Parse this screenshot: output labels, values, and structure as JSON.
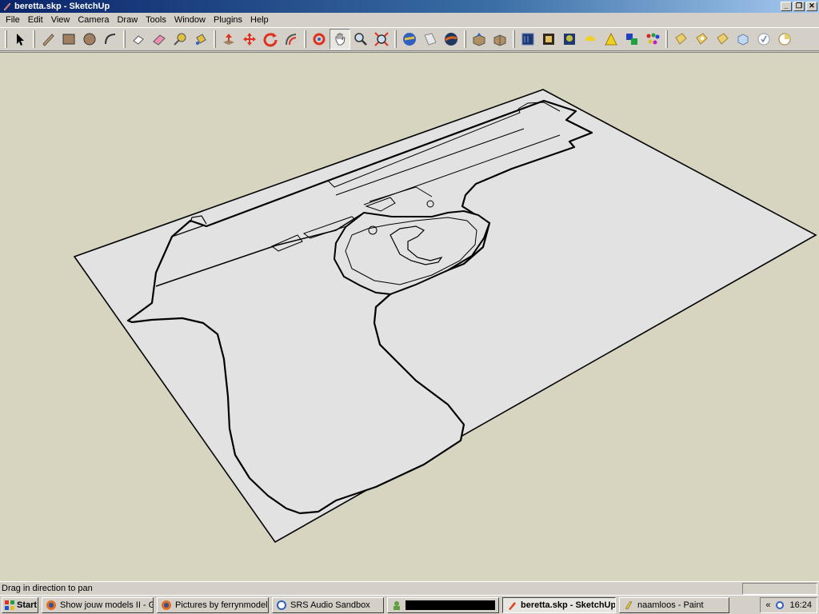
{
  "window": {
    "title": "beretta.skp - SketchUp",
    "minimize_glyph": "_",
    "maximize_glyph": "❐",
    "close_glyph": "✕"
  },
  "menu": [
    "File",
    "Edit",
    "View",
    "Camera",
    "Draw",
    "Tools",
    "Window",
    "Plugins",
    "Help"
  ],
  "toolbar": {
    "groups": [
      [
        "select-arrow-icon"
      ],
      [
        "pencil-icon",
        "rectangle-icon",
        "circle-icon",
        "arc-icon"
      ],
      [
        "make-component-icon",
        "eraser-icon",
        "tape-measure-icon",
        "paint-bucket-icon"
      ],
      [
        "push-pull-icon",
        "move-icon",
        "rotate-icon",
        "offset-icon"
      ],
      [
        "orbit-icon",
        "pan-hand-icon",
        "zoom-icon",
        "zoom-extents-icon"
      ],
      [
        "get-models-icon",
        "share-model-icon",
        "google-earth-icon"
      ],
      [
        "warehouse-upload-icon",
        "component-icon"
      ],
      [
        "section-plane-icon",
        "scenes-icon",
        "tree-icon",
        "sun-icon",
        "triangle-icon",
        "layers-icon",
        "materials-icon"
      ],
      [
        "tag1-icon",
        "tag2-icon",
        "tag3-icon",
        "cube-icon",
        "check-icon",
        "pie-icon"
      ]
    ],
    "active_tool": "pan-hand-icon"
  },
  "colors": {
    "viewport_bg": "#d7d4c0",
    "face_fill": "#e0e0e0",
    "edge": "#000000",
    "title_bar": "#0a246a"
  },
  "status": {
    "text": "Drag in direction to pan"
  },
  "taskbar": {
    "start_label": "Start",
    "tasks": [
      {
        "label": "Show jouw models II - GT...",
        "icon": "firefox-icon",
        "active": false
      },
      {
        "label": "Pictures by ferrynmodels - ...",
        "icon": "firefox-icon",
        "active": false
      },
      {
        "label": "SRS Audio Sandbox",
        "icon": "speaker-icon",
        "active": false
      },
      {
        "label": "",
        "icon": "user-icon",
        "active": false
      },
      {
        "label": "beretta.skp - SketchUp",
        "icon": "sketchup-icon",
        "active": true
      },
      {
        "label": "naamloos - Paint",
        "icon": "paint-icon",
        "active": false
      }
    ],
    "tray_chevron": "«",
    "clock": "16:24"
  }
}
